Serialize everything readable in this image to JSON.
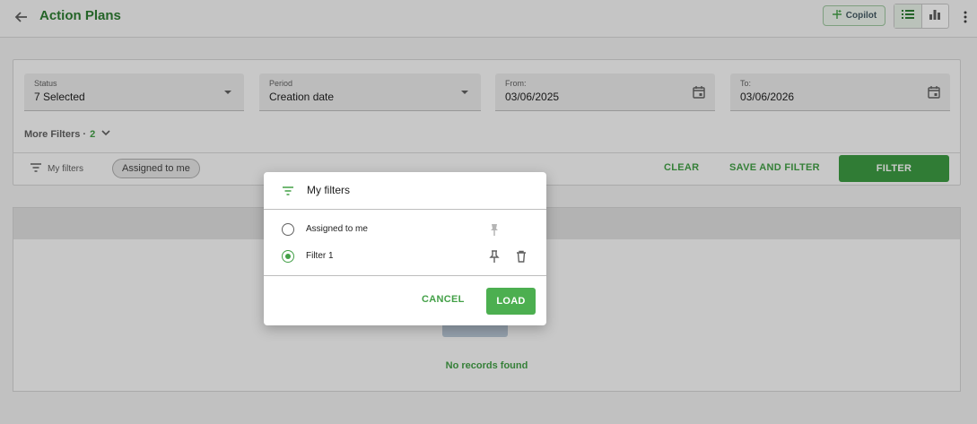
{
  "header": {
    "title": "Action Plans",
    "copilot_label": "Copilot"
  },
  "filters": {
    "status": {
      "label": "Status",
      "value": "7 Selected"
    },
    "period": {
      "label": "Period",
      "value": "Creation date"
    },
    "from": {
      "label": "From:",
      "value": "03/06/2025"
    },
    "to": {
      "label": "To:",
      "value": "03/06/2026"
    },
    "more_filters_label": "More Filters ·",
    "more_filters_count": "2",
    "my_filters_label": "My filters",
    "active_chip": "Assigned to me",
    "clear_label": "CLEAR",
    "save_and_filter_label": "SAVE AND FILTER",
    "filter_label": "FILTER"
  },
  "results": {
    "empty_text": "No records found"
  },
  "dialog": {
    "title": "My filters",
    "items": [
      {
        "label": "Assigned to me",
        "selected": false,
        "pinned": true,
        "deletable": false
      },
      {
        "label": "Filter 1",
        "selected": true,
        "pinned": false,
        "deletable": true
      }
    ],
    "cancel_label": "CANCEL",
    "load_label": "LOAD"
  },
  "colors": {
    "accent": "#43a047",
    "primary_button": "#3d9c43",
    "title": "#2e7d32"
  }
}
